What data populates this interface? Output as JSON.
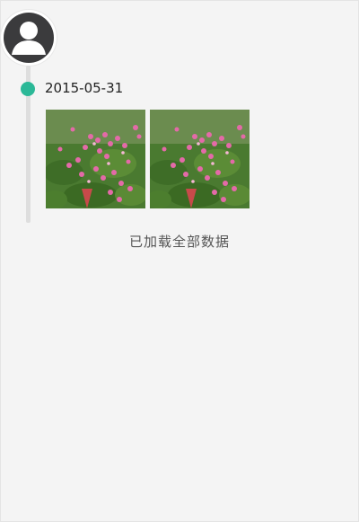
{
  "profile": {
    "avatar_icon": "user-avatar-icon"
  },
  "timeline": {
    "accent_color": "#2bb897",
    "entries": [
      {
        "date": "2015-05-31",
        "photos": [
          {
            "icon": "flower-garden-photo"
          },
          {
            "icon": "flower-garden-photo"
          }
        ]
      }
    ]
  },
  "footer": {
    "status": "已加载全部数据"
  }
}
